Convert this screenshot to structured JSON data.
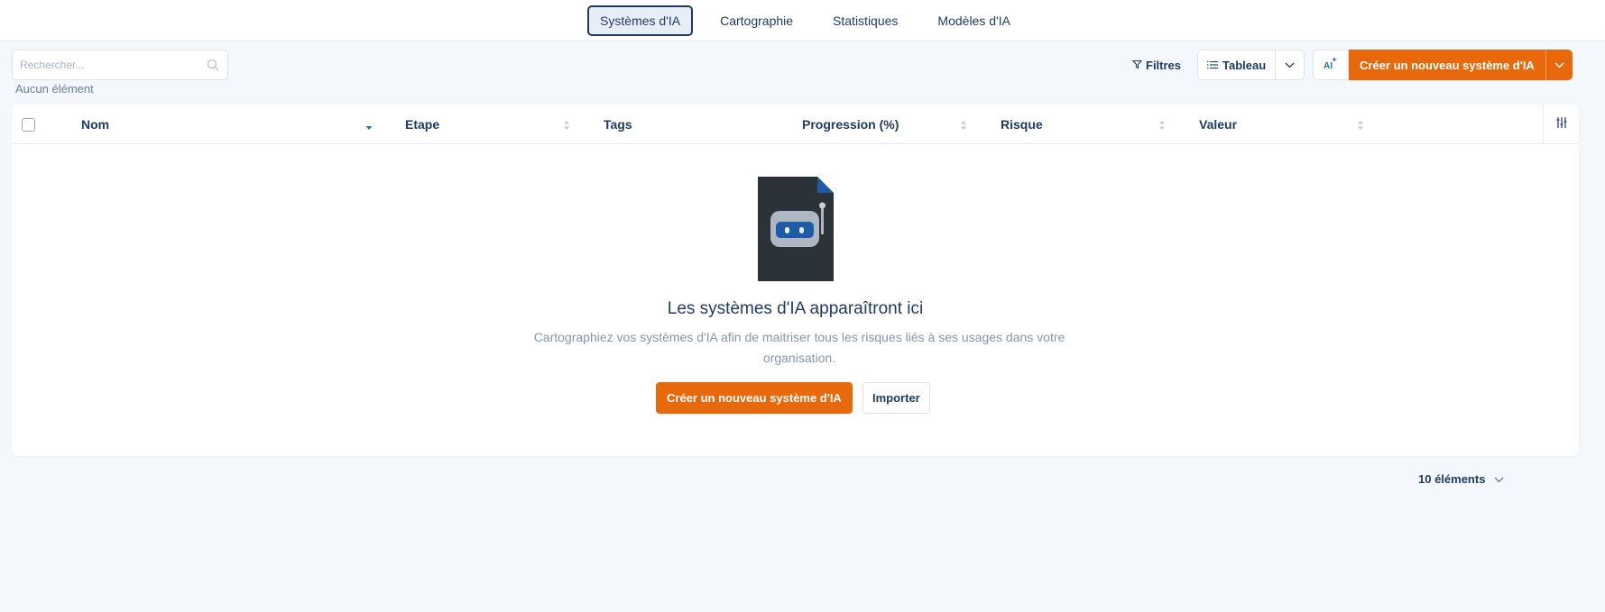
{
  "tabs": [
    {
      "label": "Systèmes d'IA",
      "active": true
    },
    {
      "label": "Cartographie",
      "active": false
    },
    {
      "label": "Statistiques",
      "active": false
    },
    {
      "label": "Modèles d'IA",
      "active": false
    }
  ],
  "toolbar": {
    "search_placeholder": "Rechercher...",
    "search_value": "",
    "no_items": "Aucun élément",
    "filters_label": "Filtres",
    "view_label": "Tableau",
    "ai_label": "AI",
    "create_label": "Créer un nouveau système d'IA"
  },
  "table": {
    "columns": [
      "Nom",
      "Etape",
      "Tags",
      "Progression (%)",
      "Risque",
      "Valeur"
    ],
    "rows": []
  },
  "empty_state": {
    "title": "Les systèmes d'IA apparaîtront ici",
    "description": "Cartographiez vos systèmes d'IA afin de maitriser tous les risques liés à ses usages dans votre organisation.",
    "create_label": "Créer un nouveau système d'IA",
    "import_label": "Importer"
  },
  "pagination": {
    "page_size_label": "10 éléments"
  },
  "colors": {
    "accent": "#e8680c",
    "navy": "#1e3a5f",
    "background": "#f4f7fb"
  }
}
